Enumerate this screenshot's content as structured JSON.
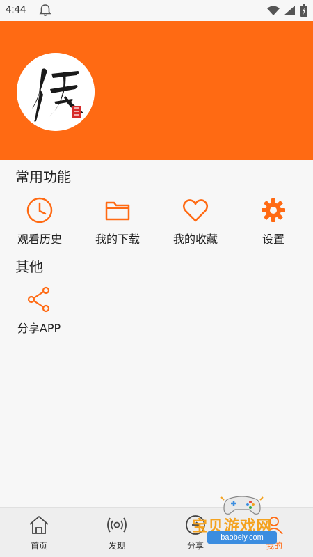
{
  "status_bar": {
    "time": "4:44"
  },
  "sections": {
    "common": {
      "title": "常用功能",
      "items": [
        {
          "label": "观看历史",
          "icon": "clock-icon"
        },
        {
          "label": "我的下载",
          "icon": "folder-icon"
        },
        {
          "label": "我的收藏",
          "icon": "heart-icon"
        },
        {
          "label": "设置",
          "icon": "gear-icon"
        }
      ]
    },
    "other": {
      "title": "其他",
      "items": [
        {
          "label": "分享APP",
          "icon": "share-icon"
        }
      ]
    }
  },
  "bottom_nav": {
    "items": [
      {
        "label": "首页",
        "icon": "home-icon"
      },
      {
        "label": "发现",
        "icon": "broadcast-icon"
      },
      {
        "label": "分享",
        "icon": "share-circle-icon"
      },
      {
        "label": "我的",
        "icon": "user-icon",
        "active": true
      }
    ]
  },
  "watermark": {
    "text": "宝贝游戏网",
    "url": "baobeiy.com"
  },
  "colors": {
    "accent": "#ff6a13",
    "watermark": "#f4a21e",
    "watermark_url_bg": "#3b8de0"
  }
}
